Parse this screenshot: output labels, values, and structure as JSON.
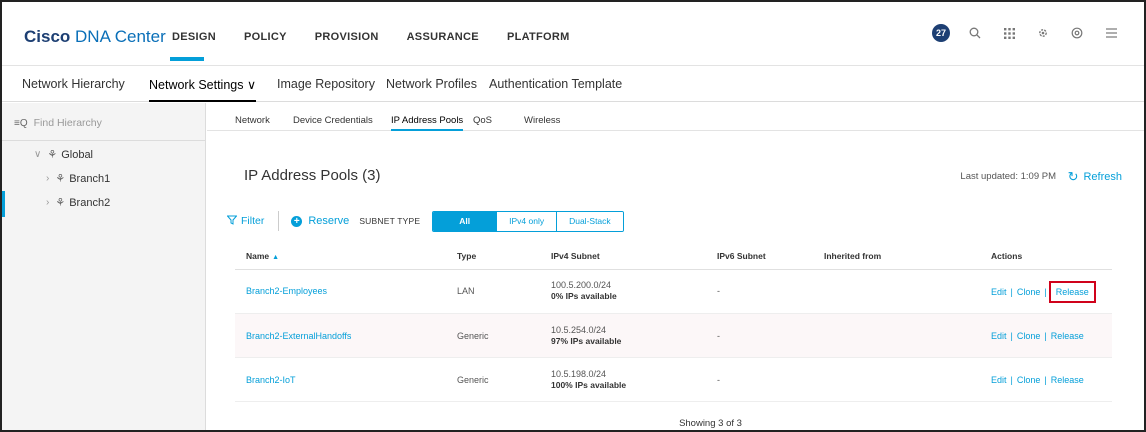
{
  "brand": {
    "cisco": "Cisco",
    "product": "DNA Center"
  },
  "main_nav": [
    "DESIGN",
    "POLICY",
    "PROVISION",
    "ASSURANCE",
    "PLATFORM"
  ],
  "header_icons": {
    "notifications_count": "27",
    "icons": [
      "notification-icon",
      "search-icon",
      "apps-grid-icon",
      "gear-icon",
      "help-icon",
      "menu-icon"
    ]
  },
  "sub_nav": [
    "Network Hierarchy",
    "Network Settings ∨",
    "Image Repository",
    "Network Profiles",
    "Authentication Template"
  ],
  "sidebar": {
    "search_placeholder": "Find Hierarchy",
    "tree": [
      {
        "label": "Global",
        "expanded": true
      },
      {
        "label": "Branch1",
        "expanded": false
      },
      {
        "label": "Branch2",
        "expanded": false,
        "selected": true
      }
    ]
  },
  "tabs": [
    "Network",
    "Device Credentials",
    "IP Address Pools",
    "QoS",
    "Wireless"
  ],
  "main": {
    "title": "IP Address Pools (3)",
    "last_updated": "Last updated: 1:09 PM",
    "refresh": "Refresh",
    "filter": "Filter",
    "reserve": "Reserve",
    "subnet_type_label": "SUBNET TYPE",
    "subnet_types": [
      "All",
      "IPv4 only",
      "Dual-Stack"
    ],
    "selected_subnet_type": "All"
  },
  "table": {
    "columns": [
      "Name",
      "Type",
      "IPv4 Subnet",
      "IPv6 Subnet",
      "Inherited from",
      "Actions"
    ],
    "rows": [
      {
        "name": "Branch2-Employees",
        "type": "LAN",
        "subnet": "100.5.200.0/24",
        "avail": "0% IPs available",
        "ipv6": "-",
        "inherited": ""
      },
      {
        "name": "Branch2-ExternalHandoffs",
        "type": "Generic",
        "subnet": "10.5.254.0/24",
        "avail": "97% IPs available",
        "ipv6": "-",
        "inherited": ""
      },
      {
        "name": "Branch2-IoT",
        "type": "Generic",
        "subnet": "10.5.198.0/24",
        "avail": "100% IPs available",
        "ipv6": "-",
        "inherited": ""
      }
    ],
    "actions": {
      "edit": "Edit",
      "clone": "Clone",
      "release": "Release",
      "sep": "|"
    },
    "footer": "Showing 3 of 3"
  },
  "colors": {
    "accent": "#049fd9",
    "brand_dark": "#1d3f73",
    "highlight": "#d0021b"
  }
}
